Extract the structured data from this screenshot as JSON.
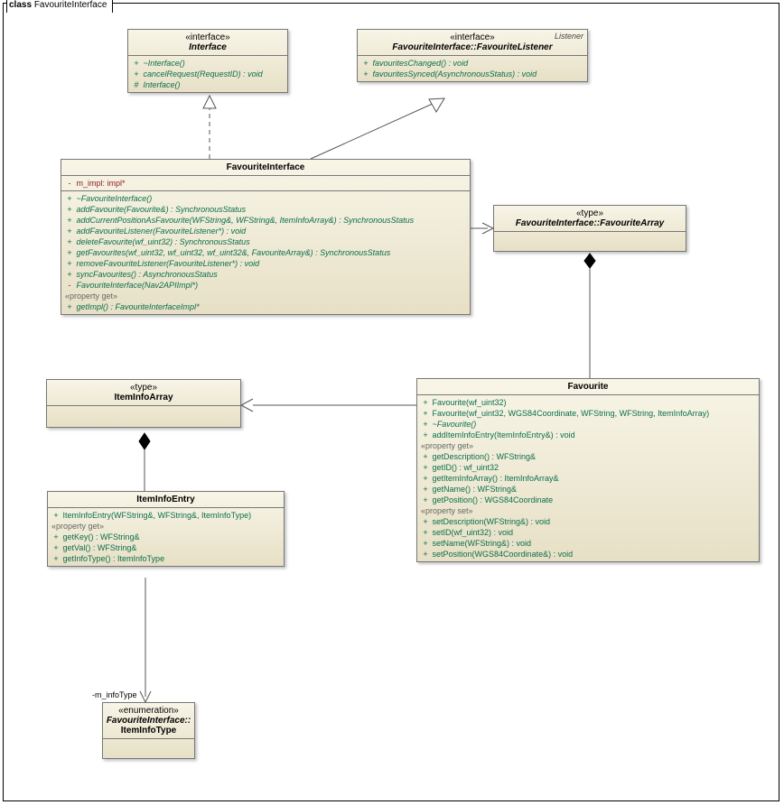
{
  "frame": {
    "keyword": "class",
    "name": "FavouriteInterface"
  },
  "interface": {
    "stereo": "«interface»",
    "name": "Interface",
    "ops": [
      {
        "vis": "+",
        "sig": "~Interface()"
      },
      {
        "vis": "+",
        "sig": "cancelRequest(RequestID) : void"
      },
      {
        "vis": "#",
        "sig": "Interface()"
      }
    ]
  },
  "listener": {
    "corner": "Listener",
    "stereo": "«interface»",
    "name": "FavouriteInterface::FavouriteListener",
    "ops": [
      {
        "vis": "+",
        "sig": "favouritesChanged() : void"
      },
      {
        "vis": "+",
        "sig": "favouritesSynced(AsynchronousStatus) : void"
      }
    ]
  },
  "favInterface": {
    "name": "FavouriteInterface",
    "attrs": [
      {
        "vis": "-",
        "sig": "m_impl:  impl*"
      }
    ],
    "ops": [
      {
        "vis": "+",
        "sig": "~FavouriteInterface()"
      },
      {
        "vis": "+",
        "sig": "addFavourite(Favourite&) : SynchronousStatus"
      },
      {
        "vis": "+",
        "sig": "addCurrentPositionAsFavourite(WFString&, WFString&, ItemInfoArray&) : SynchronousStatus"
      },
      {
        "vis": "+",
        "sig": "addFavouriteListener(FavouriteListener*) : void"
      },
      {
        "vis": "+",
        "sig": "deleteFavourite(wf_uint32) : SynchronousStatus"
      },
      {
        "vis": "+",
        "sig": "getFavourites(wf_uint32, wf_uint32, wf_uint32&, FavouriteArray&) : SynchronousStatus"
      },
      {
        "vis": "+",
        "sig": "removeFavouriteListener(FavouriteListener*) : void"
      },
      {
        "vis": "+",
        "sig": "syncFavourites() : AsynchronousStatus"
      },
      {
        "vis": "-",
        "sig": "FavouriteInterface(Nav2APIImpl*)"
      }
    ],
    "propGetLabel": "«property get»",
    "propsGet": [
      {
        "vis": "+",
        "sig": "getImpl() : FavouriteInterfaceImpl*"
      }
    ]
  },
  "favArray": {
    "stereo": "«type»",
    "name": "FavouriteInterface::FavouriteArray"
  },
  "itemInfoArray": {
    "stereo": "«type»",
    "name": "ItemInfoArray"
  },
  "itemInfoEntry": {
    "name": "ItemInfoEntry",
    "ops": [
      {
        "vis": "+",
        "sig": "ItemInfoEntry(WFString&, WFString&, ItemInfoType)"
      }
    ],
    "propGetLabel": "«property get»",
    "propsGet": [
      {
        "vis": "+",
        "sig": "getKey() : WFString&"
      },
      {
        "vis": "+",
        "sig": "getVal() : WFString&"
      },
      {
        "vis": "+",
        "sig": "getInfoType() : ItemInfoType"
      }
    ]
  },
  "favourite": {
    "name": "Favourite",
    "ops": [
      {
        "vis": "+",
        "sig": "Favourite(wf_uint32)"
      },
      {
        "vis": "+",
        "sig": "Favourite(wf_uint32, WGS84Coordinate, WFString, WFString, ItemInfoArray)"
      },
      {
        "vis": "+",
        "sig": "~Favourite()"
      },
      {
        "vis": "+",
        "sig": "addItemInfoEntry(ItemInfoEntry&) : void"
      }
    ],
    "propGetLabel": "«property get»",
    "propsGet": [
      {
        "vis": "+",
        "sig": "getDescription() : WFString&"
      },
      {
        "vis": "+",
        "sig": "getID() : wf_uint32"
      },
      {
        "vis": "+",
        "sig": "getItemInfoArray() : ItemInfoArray&"
      },
      {
        "vis": "+",
        "sig": "getName() : WFString&"
      },
      {
        "vis": "+",
        "sig": "getPosition() : WGS84Coordinate"
      }
    ],
    "propSetLabel": "«property set»",
    "propsSet": [
      {
        "vis": "+",
        "sig": "setDescription(WFString&) : void"
      },
      {
        "vis": "+",
        "sig": "setID(wf_uint32) : void"
      },
      {
        "vis": "+",
        "sig": "setName(WFString&) : void"
      },
      {
        "vis": "+",
        "sig": "setPosition(WGS84Coordinate&) : void"
      }
    ]
  },
  "itemInfoType": {
    "stereo": "«enumeration»",
    "name1": "FavouriteInterface::",
    "name2": "ItemInfoType"
  },
  "labels": {
    "mInfoType": "-m_infoType"
  }
}
